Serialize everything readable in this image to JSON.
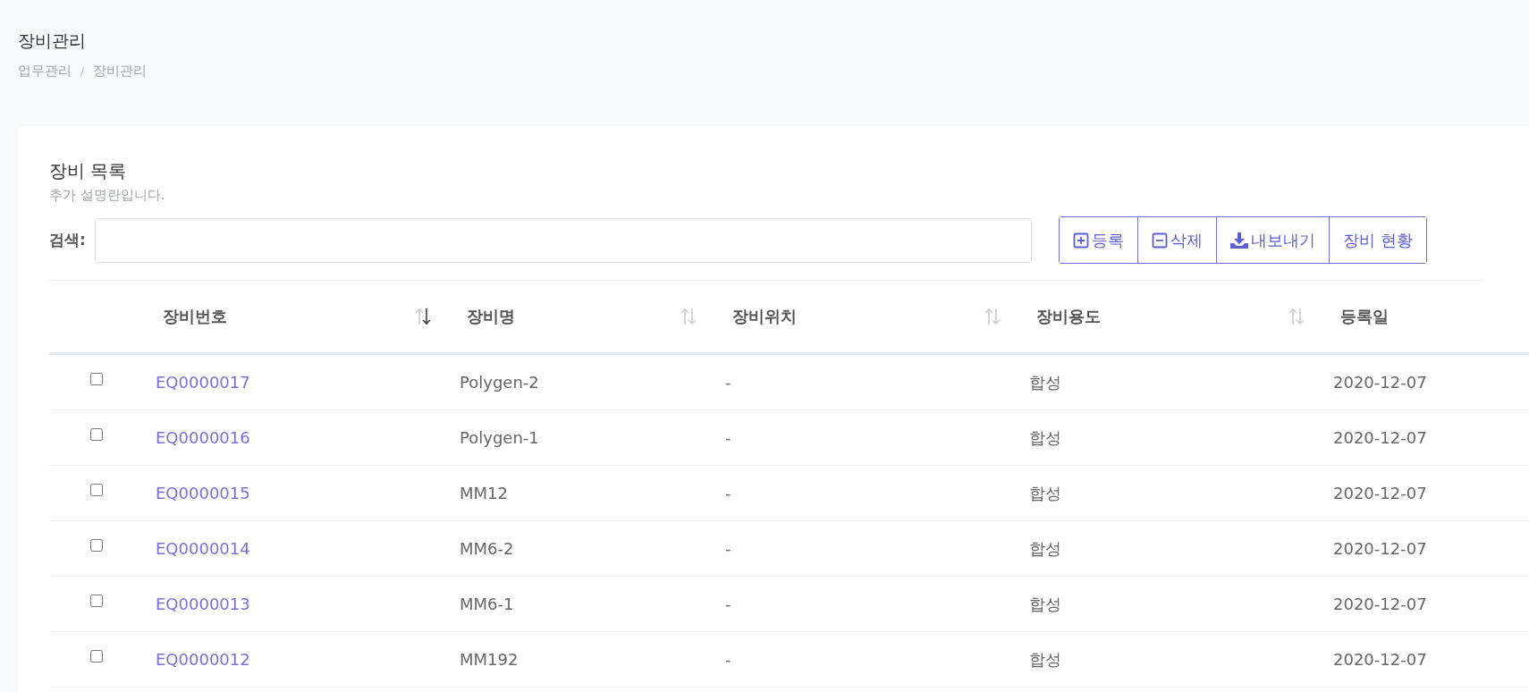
{
  "page": {
    "title": "장비관리",
    "breadcrumb": [
      "업무관리",
      "장비관리"
    ],
    "breadcrumb_separator": "/"
  },
  "card": {
    "title": "장비 목록",
    "description": "추가 설명란입니다."
  },
  "search": {
    "label": "검색:"
  },
  "buttons": [
    {
      "label": "등록",
      "kind": "add"
    },
    {
      "label": "삭제",
      "kind": "remove"
    },
    {
      "label": "내보내기",
      "kind": "export"
    },
    {
      "label": "장비 현황",
      "kind": "text"
    }
  ],
  "table": {
    "columns": [
      {
        "label": "장비번호",
        "sorted": true
      },
      {
        "label": "장비명",
        "sorted": false
      },
      {
        "label": "장비위치",
        "sorted": false
      },
      {
        "label": "장비용도",
        "sorted": false
      },
      {
        "label": "등록일"
      }
    ],
    "rows": [
      {
        "checked": false,
        "cells": [
          "EQ0000017",
          "Polygen-2",
          "-",
          "합성",
          "2020-12-07"
        ]
      },
      {
        "checked": false,
        "cells": [
          "EQ0000016",
          "Polygen-1",
          "-",
          "합성",
          "2020-12-07"
        ]
      },
      {
        "checked": false,
        "cells": [
          "EQ0000015",
          "MM12",
          "-",
          "합성",
          "2020-12-07"
        ]
      },
      {
        "checked": false,
        "cells": [
          "EQ0000014",
          "MM6-2",
          "-",
          "합성",
          "2020-12-07"
        ]
      },
      {
        "checked": false,
        "cells": [
          "EQ0000013",
          "MM6-1",
          "-",
          "합성",
          "2020-12-07"
        ]
      },
      {
        "checked": false,
        "cells": [
          "EQ0000012",
          "MM192",
          "-",
          "합성",
          "2020-12-07"
        ]
      }
    ]
  }
}
